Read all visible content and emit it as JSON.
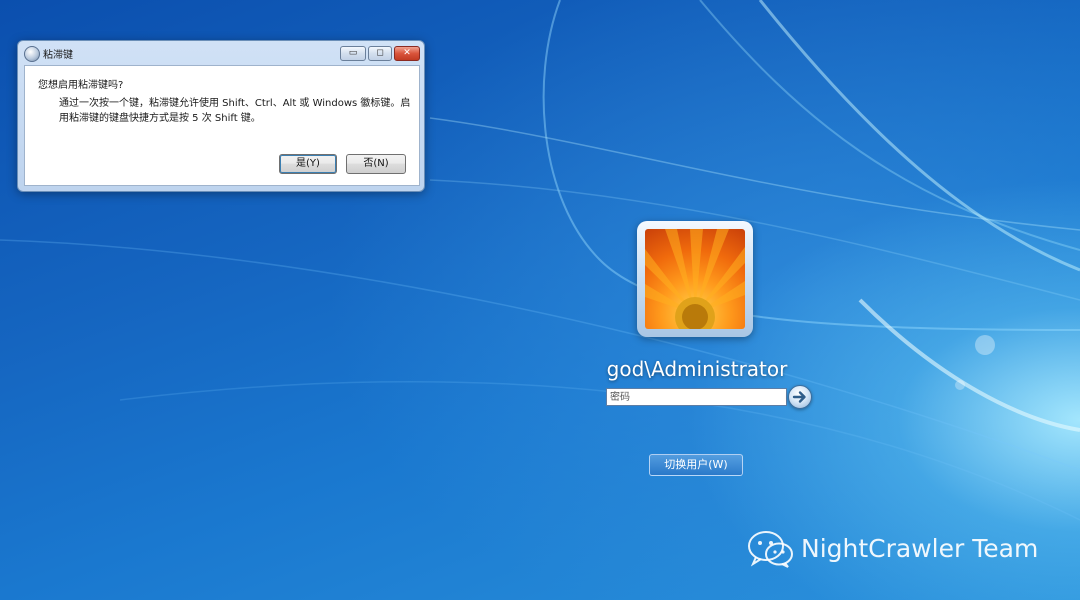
{
  "dialog": {
    "title": "粘滞键",
    "controls": {
      "minimize": "▭",
      "maximize": "◻",
      "close": "✕"
    },
    "question": "您想启用粘滞键吗?",
    "message": "通过一次按一个键，粘滞键允许使用 Shift、Ctrl、Alt 或 Windows 徽标键。启用粘滞键的键盘快捷方式是按 5 次 Shift 键。",
    "yes_button": "是(Y)",
    "no_button": "否(N)"
  },
  "login": {
    "username": "god\\Administrator",
    "password_placeholder": "密码",
    "switch_user_button": "切换用户(W)"
  },
  "watermark": {
    "text": "NightCrawler Team",
    "icon": "wechat-icon"
  },
  "colors": {
    "desktop_blue": "#1565c0",
    "dialog_frame": "#c3d7f0",
    "close_red": "#c23b22"
  }
}
